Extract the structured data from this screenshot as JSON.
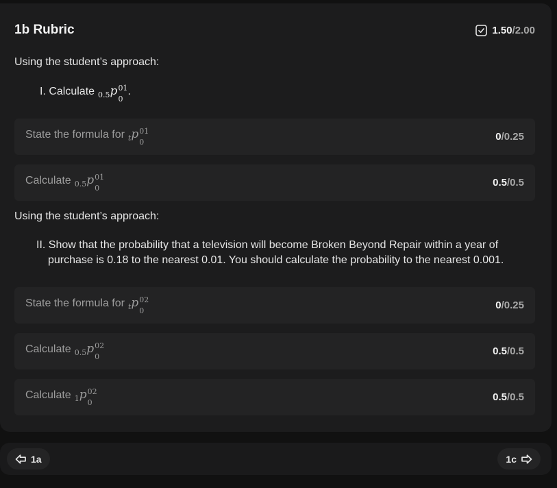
{
  "header": {
    "title": "1b Rubric",
    "score_awarded": "1.50",
    "score_max": "/2.00"
  },
  "section1": {
    "intro": "Using the student’s approach:",
    "task_prefix": "I. Calculate",
    "task_math": {
      "left_sub": "0.5",
      "p": "p",
      "sup": "01",
      "sub": "0"
    },
    "task_suffix": "."
  },
  "section2": {
    "intro": "Using the student’s approach:",
    "task": "II. Show that the probability that a television will become Broken Beyond Repair within a year of purchase is 0.18 to the nearest 0.01. You should calculate the probability to the nearest 0.001."
  },
  "criteria": [
    {
      "label": "State the formula for",
      "math": {
        "left_sub": "t",
        "sup": "01",
        "sub": "0"
      },
      "awarded": "0",
      "max": "/0.25"
    },
    {
      "label": "Calculate",
      "math": {
        "left_sub": "0.5",
        "sup": "01",
        "sub": "0"
      },
      "awarded": "0.5",
      "max": "/0.5"
    },
    {
      "label": "State the formula for",
      "math": {
        "left_sub": "t",
        "sup": "02",
        "sub": "0"
      },
      "awarded": "0",
      "max": "/0.25"
    },
    {
      "label": "Calculate",
      "math": {
        "left_sub": "0.5",
        "sup": "02",
        "sub": "0"
      },
      "awarded": "0.5",
      "max": "/0.5"
    },
    {
      "label": "Calculate",
      "math": {
        "left_sub": "1",
        "sup": "02",
        "sub": "0"
      },
      "awarded": "0.5",
      "max": "/0.5"
    }
  ],
  "footer": {
    "prev_label": "1a",
    "next_label": "1c"
  },
  "icons": {
    "score": "checkbox-icon",
    "prev": "arrow-left-icon",
    "next": "arrow-right-icon"
  },
  "colors": {
    "background": "#111111",
    "panel": "#1c1c1d",
    "row": "#232324",
    "muted_text": "#9c9c9c"
  }
}
